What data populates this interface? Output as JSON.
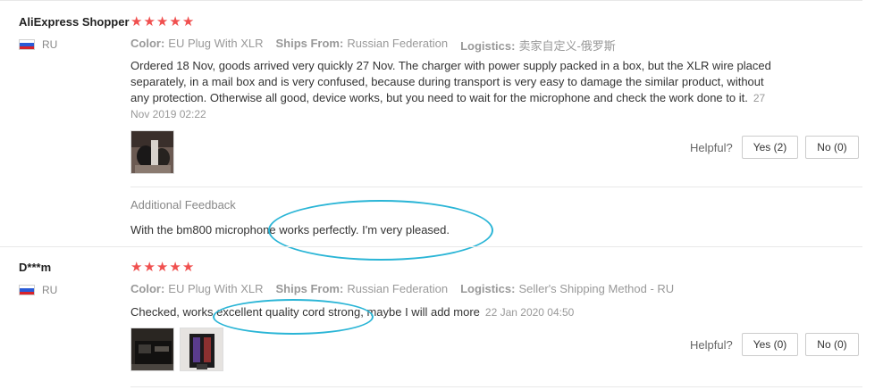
{
  "reviews": [
    {
      "buyer": "AliExpress Shopper",
      "country": "RU",
      "rating": 5,
      "color_label": "Color:",
      "color_value": "EU Plug With XLR",
      "ships_label": "Ships From:",
      "ships_value": "Russian Federation",
      "logistics_label": "Logistics:",
      "logistics_value": "卖家自定义-俄罗斯",
      "text": "Ordered 18 Nov, goods arrived very quickly 27 Nov. The charger with power supply packed in a box, but the XLR wire placed separately, in a mail box and is very confused, because during transport is very easy to damage the similar product, without any protection. Otherwise all good, device works, but you need to wait for the microphone and check the work done to it.",
      "date": "27 Nov 2019 02:22",
      "helpful_label": "Helpful?",
      "yes_label": "Yes (2)",
      "no_label": "No (0)",
      "additional_title": "Additional Feedback",
      "additional_text": "With the bm800 microphone works perfectly. I'm very pleased."
    },
    {
      "buyer": "D***m",
      "country": "RU",
      "rating": 5,
      "color_label": "Color:",
      "color_value": "EU Plug With XLR",
      "ships_label": "Ships From:",
      "ships_value": "Russian Federation",
      "logistics_label": "Logistics:",
      "logistics_value": "Seller's Shipping Method - RU",
      "text": "Checked, works excellent quality cord strong, maybe I will add more",
      "date": "22 Jan 2020 04:50",
      "helpful_label": "Helpful?",
      "yes_label": "Yes (0)",
      "no_label": "No (0)"
    }
  ],
  "colors": {
    "star": "#f0504f",
    "annotation": "#2ab5d6"
  }
}
